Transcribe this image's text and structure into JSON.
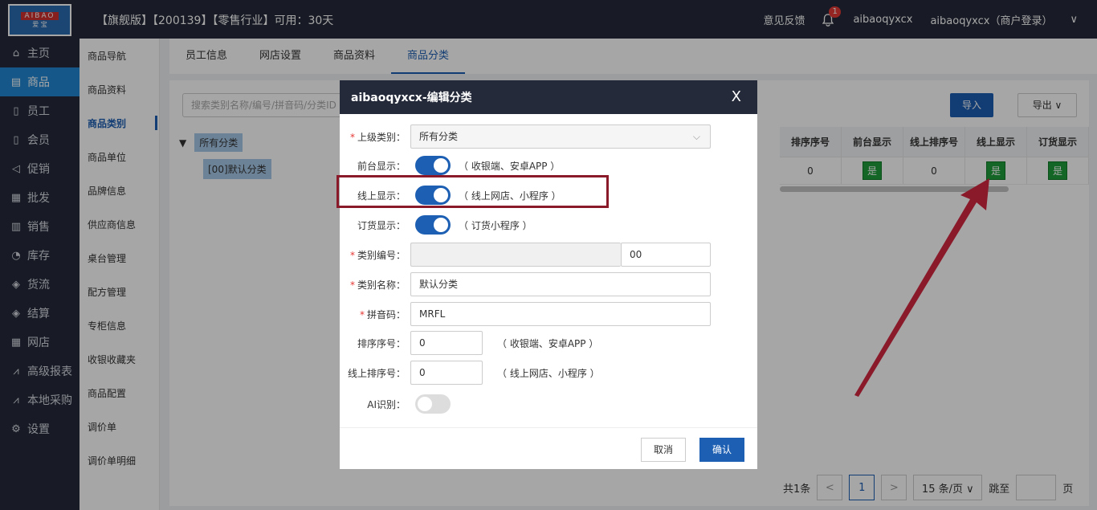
{
  "topbar": {
    "logo_top": "AIBAO",
    "logo_bottom": "爱 宝",
    "title": "【旗舰版】【200139】【零售行业】可用：30天",
    "feedback": "意见反馈",
    "badge": "1",
    "user1": "aibaoqyxcx",
    "user2": "aibaoqyxcx（商户登录）",
    "chevron": "∨"
  },
  "sidebar": {
    "items": [
      {
        "icon": "⌂",
        "label": "主页"
      },
      {
        "icon": "▤",
        "label": "商品"
      },
      {
        "icon": "▯",
        "label": "员工"
      },
      {
        "icon": "▯",
        "label": "会员"
      },
      {
        "icon": "◁",
        "label": "促销"
      },
      {
        "icon": "▦",
        "label": "批发"
      },
      {
        "icon": "▥",
        "label": "销售"
      },
      {
        "icon": "◔",
        "label": "库存"
      },
      {
        "icon": "◈",
        "label": "货流"
      },
      {
        "icon": "◈",
        "label": "结算"
      },
      {
        "icon": "▦",
        "label": "网店"
      },
      {
        "icon": "⩘",
        "label": "高级报表"
      },
      {
        "icon": "⩘",
        "label": "本地采购"
      },
      {
        "icon": "⚙",
        "label": "设置"
      }
    ]
  },
  "subnav": {
    "items": [
      "商品导航",
      "商品资料",
      "商品类别",
      "商品单位",
      "品牌信息",
      "供应商信息",
      "桌台管理",
      "配方管理",
      "专柜信息",
      "收银收藏夹",
      "商品配置",
      "调价单",
      "调价单明细"
    ]
  },
  "tabs": [
    "员工信息",
    "网店设置",
    "商品资料",
    "商品分类"
  ],
  "toolbar": {
    "search_placeholder": "搜索类别名称/编号/拼音码/分类ID",
    "import": "导入",
    "export": "导出 ∨"
  },
  "tree": {
    "toggle": "▼",
    "root": "所有分类",
    "child": "[00]默认分类"
  },
  "grid": {
    "headers": [
      "排序序号",
      "前台显示",
      "线上排序号",
      "线上显示",
      "订货显示"
    ],
    "row": [
      "0",
      "是",
      "0",
      "是",
      "是"
    ]
  },
  "pager": {
    "total": "共1条",
    "prev": "<",
    "page": "1",
    "next": ">",
    "size": "15 条/页 ∨",
    "jump": "跳至",
    "unit": "页"
  },
  "modal": {
    "title": "aibaoqyxcx-编辑分类",
    "close": "X",
    "parent_label": "上级类别：",
    "parent_value": "所有分类",
    "front_label": "前台显示：",
    "front_hint": "（ 收银端、安卓APP ）",
    "online_label": "线上显示：",
    "online_hint": "（ 线上网店、小程序 ）",
    "order_label": "订货显示：",
    "order_hint": "（ 订货小程序 ）",
    "code_label": "类别编号：",
    "code_value": "00",
    "name_label": "类别名称：",
    "name_value": "默认分类",
    "pinyin_label": "拼音码：",
    "pinyin_value": "MRFL",
    "sort_label": "排序序号：",
    "sort_value": "0",
    "sort_hint": "（ 收银端、安卓APP ）",
    "online_sort_label": "线上排序号：",
    "online_sort_value": "0",
    "online_sort_hint": "（ 线上网店、小程序 ）",
    "ai_label": "AI识别：",
    "cancel": "取消",
    "ok": "确认"
  }
}
